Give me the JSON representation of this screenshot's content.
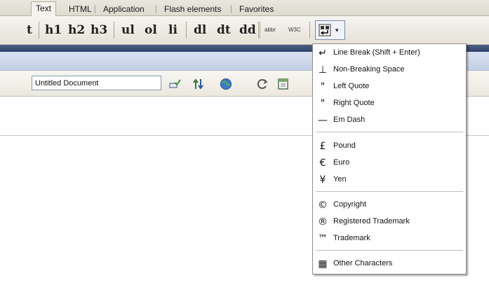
{
  "tabs": [
    {
      "label": "Text",
      "active": true
    },
    {
      "label": "HTML",
      "active": false
    },
    {
      "label": "Application",
      "active": false
    },
    {
      "label": "Flash elements",
      "active": false
    },
    {
      "label": "Favorites",
      "active": false
    }
  ],
  "toolbar": {
    "items": [
      "t",
      "h1",
      "h2",
      "h3",
      "ul",
      "ol",
      "li",
      "dl",
      "dt",
      "dd"
    ],
    "abbr_label": "abbr",
    "w3c_label": "W3C",
    "characters_button_arrow": "▾"
  },
  "document_toolbar": {
    "title_value": "Untitled Document"
  },
  "characters_menu": {
    "groups": [
      [
        {
          "icon": "line-break-icon",
          "glyph": "↵",
          "label": "Line Break (Shift + Enter)"
        },
        {
          "icon": "non-breaking-space-icon",
          "glyph": "⊥",
          "label": "Non-Breaking Space"
        },
        {
          "icon": "left-quote-icon",
          "glyph": "\"",
          "label": "Left Quote"
        },
        {
          "icon": "right-quote-icon",
          "glyph": "\"",
          "label": "Right Quote"
        },
        {
          "icon": "em-dash-icon",
          "glyph": "—",
          "label": "Em Dash"
        }
      ],
      [
        {
          "icon": "pound-icon",
          "glyph": "£",
          "label": "Pound"
        },
        {
          "icon": "euro-icon",
          "glyph": "€",
          "label": "Euro"
        },
        {
          "icon": "yen-icon",
          "glyph": "¥",
          "label": "Yen"
        }
      ],
      [
        {
          "icon": "copyright-icon",
          "glyph": "©",
          "label": "Copyright"
        },
        {
          "icon": "registered-trademark-icon",
          "glyph": "®",
          "label": "Registered Trademark"
        },
        {
          "icon": "trademark-icon",
          "glyph": "™",
          "label": "Trademark"
        }
      ],
      [
        {
          "icon": "other-characters-icon",
          "glyph": "▦",
          "label": "Other Characters"
        }
      ]
    ]
  },
  "colors": {
    "accent_blue": "#2e4068",
    "titlebar_blue": "#c2d0e6"
  }
}
